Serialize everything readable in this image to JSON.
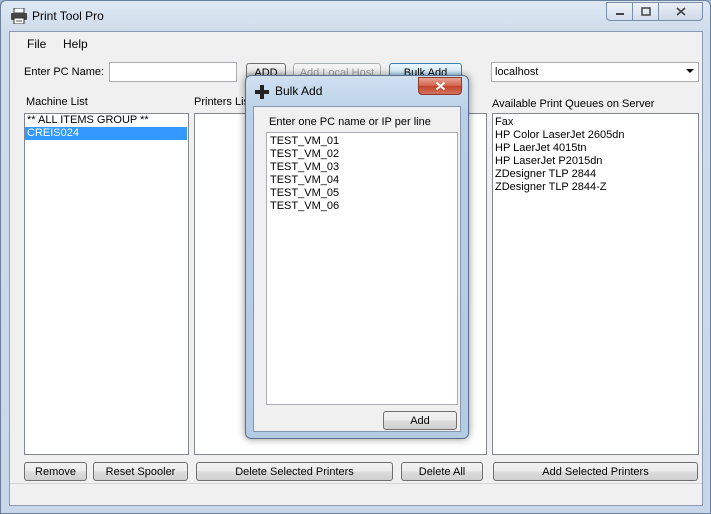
{
  "window": {
    "title": "Print Tool Pro",
    "icon": "printer-icon",
    "caption_buttons": [
      "minimize-icon",
      "maximize-icon",
      "close-icon"
    ]
  },
  "menu": {
    "file": "File",
    "help": "Help"
  },
  "toolbar": {
    "pc_name_label": "Enter PC Name:",
    "pc_name_value": "",
    "add_label": "ADD",
    "add_local_host_label": "Add Local Host",
    "bulk_add_label": "Bulk Add",
    "server_selected": "localhost"
  },
  "machine_list": {
    "label": "Machine List",
    "items": [
      {
        "text": "** ALL ITEMS GROUP **",
        "selected": false
      },
      {
        "text": "CREIS024",
        "selected": true
      }
    ]
  },
  "printers_list": {
    "label": "Printers List"
  },
  "queues": {
    "label": "Available Print Queues on Server",
    "items": [
      "Fax",
      "HP Color LaserJet 2605dn",
      "HP LaerJet 4015tn",
      "HP LaserJet P2015dn",
      "ZDesigner TLP 2844",
      "ZDesigner TLP 2844-Z"
    ]
  },
  "bottom_buttons": {
    "remove": "Remove",
    "reset_spooler": "Reset Spooler",
    "delete_selected": "Delete Selected Printers",
    "delete_all": "Delete All",
    "add_selected": "Add Selected Printers"
  },
  "dialog": {
    "title": "Bulk Add",
    "icon": "plus-icon",
    "instruction": "Enter one PC name or IP per line",
    "lines": [
      "TEST_VM_01",
      "TEST_VM_02",
      "TEST_VM_03",
      "TEST_VM_04",
      "TEST_VM_05",
      "TEST_VM_06"
    ],
    "add_button": "Add"
  }
}
